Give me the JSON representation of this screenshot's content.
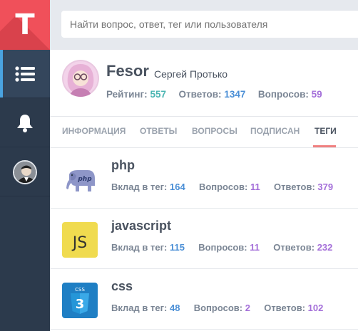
{
  "app": {
    "logo_letter": "T"
  },
  "search": {
    "placeholder": "Найти вопрос, ответ, тег или пользователя"
  },
  "sidebar": {
    "items": [
      {
        "icon": "list-icon"
      },
      {
        "icon": "bell-icon"
      },
      {
        "icon": "user-avatar"
      }
    ]
  },
  "profile": {
    "nick": "Fesor",
    "fullname": "Сергей Протько",
    "rating_label": "Рейтинг:",
    "rating_value": "557",
    "answers_label": "Ответов:",
    "answers_value": "1347",
    "questions_label": "Вопросов:",
    "questions_value": "59"
  },
  "tabs": [
    {
      "label": "ИНФОРМАЦИЯ"
    },
    {
      "label": "ОТВЕТЫ"
    },
    {
      "label": "ВОПРОСЫ"
    },
    {
      "label": "ПОДПИСАН"
    },
    {
      "label": "ТЕГИ"
    }
  ],
  "tags": [
    {
      "name": "php",
      "icon": "php-elephant-icon",
      "contrib_label": "Вклад в тег:",
      "contrib": "164",
      "questions_label": "Вопросов:",
      "questions": "11",
      "answers_label": "Ответов:",
      "answers": "379"
    },
    {
      "name": "javascript",
      "icon": "js-icon",
      "icon_text": "JS",
      "contrib_label": "Вклад в тег:",
      "contrib": "115",
      "questions_label": "Вопросов:",
      "questions": "11",
      "answers_label": "Ответов:",
      "answers": "232"
    },
    {
      "name": "css",
      "icon": "css3-shield-icon",
      "icon_text": "CSS",
      "icon_number": "3",
      "contrib_label": "Вклад в тег:",
      "contrib": "48",
      "questions_label": "Вопросов:",
      "questions": "2",
      "answers_label": "Ответов:",
      "answers": "102"
    }
  ],
  "colors": {
    "sidebar": "#2c3a4c",
    "logo": "#f0505a",
    "accent_blue": "#4aa3e0",
    "rating": "#4ab5b2",
    "answers": "#4b8fd6",
    "questions": "#a46fd9",
    "tab_underline": "#f08080"
  }
}
